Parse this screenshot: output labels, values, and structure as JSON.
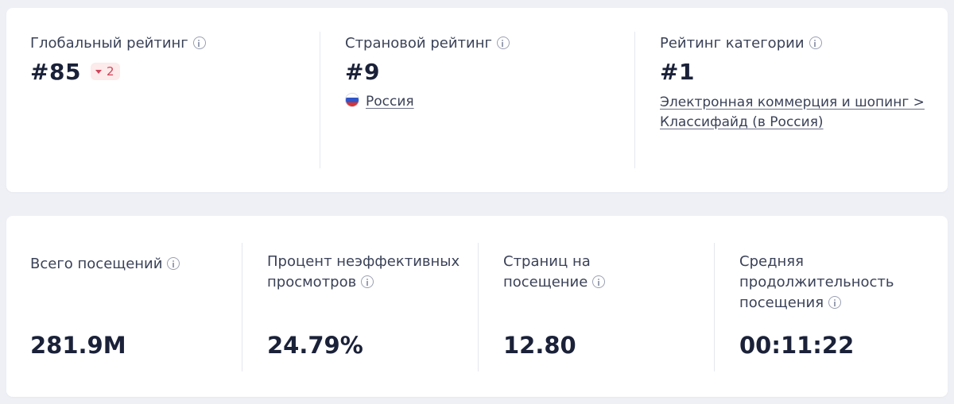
{
  "colors": {
    "badge_text": "#d0455a",
    "badge_bg": "#fdeaea",
    "flag_white": "#ffffff",
    "flag_blue": "#2f55c8",
    "flag_red": "#d83232"
  },
  "ranks": {
    "global": {
      "label": "Глобальный рейтинг",
      "value": "#85",
      "change": "2",
      "change_icon": "triangle-down-icon"
    },
    "country": {
      "label": "Страновой рейтинг",
      "value": "#9",
      "country_name": "Россия",
      "flag_icon": "russia-flag-icon"
    },
    "category": {
      "label": "Рейтинг категории",
      "value": "#1",
      "link_line1": "Электронная коммерция и шопинг >",
      "link_line2": "Классифайд (в Россия)"
    }
  },
  "metrics": [
    {
      "label_lines": [
        "Всего посещений"
      ],
      "value": "281.9M"
    },
    {
      "label_lines": [
        "Процент неэффективных",
        "просмотров"
      ],
      "value": "24.79%"
    },
    {
      "label_lines": [
        "Страниц на",
        "посещение"
      ],
      "value": "12.80"
    },
    {
      "label_lines": [
        "Средняя",
        "продолжительность",
        "посещения"
      ],
      "value": "00:11:22"
    }
  ]
}
